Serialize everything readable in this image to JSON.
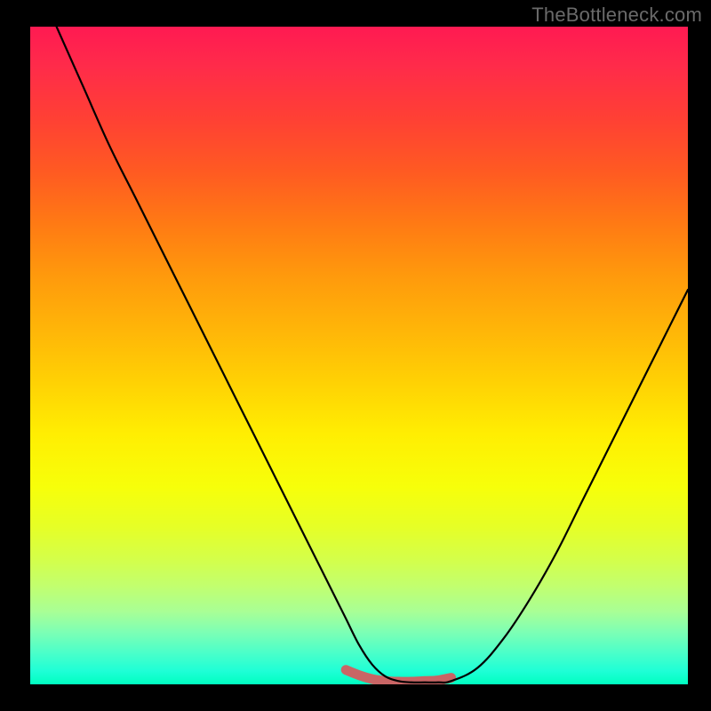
{
  "watermark": "TheBottleneck.com",
  "chart_data": {
    "type": "line",
    "title": "",
    "xlabel": "",
    "ylabel": "",
    "xlim": [
      0,
      100
    ],
    "ylim": [
      0,
      100
    ],
    "grid": false,
    "background": "rainbow-heat-gradient",
    "series": [
      {
        "name": "primary-curve",
        "color": "#000000",
        "x": [
          4,
          8,
          12,
          16,
          20,
          24,
          28,
          32,
          36,
          40,
          44,
          46,
          48,
          50,
          52,
          54,
          56,
          58,
          60,
          62,
          64,
          68,
          72,
          76,
          80,
          84,
          88,
          92,
          96,
          100
        ],
        "y": [
          100,
          91,
          82,
          74,
          66,
          58,
          50,
          42,
          34,
          26,
          18,
          14,
          10,
          6,
          3,
          1.2,
          0.5,
          0.3,
          0.3,
          0.3,
          0.5,
          2.5,
          7,
          13,
          20,
          28,
          36,
          44,
          52,
          60
        ]
      },
      {
        "name": "bottom-highlight",
        "color": "#d66a6a",
        "x": [
          48,
          50,
          52,
          54,
          56,
          58,
          60,
          62,
          64
        ],
        "y": [
          2.2,
          1.4,
          0.8,
          0.5,
          0.4,
          0.4,
          0.5,
          0.6,
          1.0
        ]
      }
    ]
  }
}
